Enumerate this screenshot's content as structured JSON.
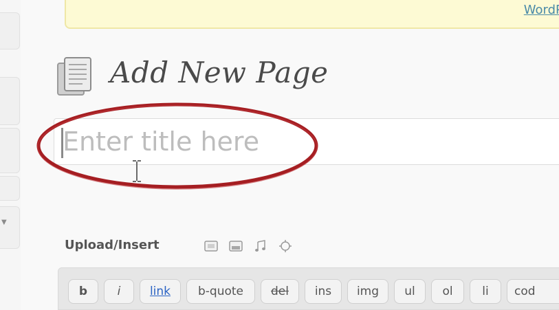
{
  "notice": {
    "link_text": "WordPr"
  },
  "heading": {
    "title": "Add New Page",
    "icon": "page-stack-icon"
  },
  "title_field": {
    "placeholder": "Enter title here",
    "value": ""
  },
  "annotation": {
    "shape": "red-ellipse",
    "color": "#a51e22"
  },
  "upload": {
    "label": "Upload/Insert",
    "buttons": [
      {
        "name": "add-image-button",
        "icon": "image-icon"
      },
      {
        "name": "add-video-button",
        "icon": "video-icon"
      },
      {
        "name": "add-audio-button",
        "icon": "music-note-icon"
      },
      {
        "name": "add-media-button",
        "icon": "star-icon"
      }
    ]
  },
  "quicktags": {
    "buttons": [
      "b",
      "i",
      "link",
      "b-quote",
      "del",
      "ins",
      "img",
      "ul",
      "ol",
      "li",
      "cod"
    ]
  },
  "colors": {
    "notice_bg": "#fdfad4",
    "link": "#2b63c4",
    "accent_red": "#a51e22"
  }
}
